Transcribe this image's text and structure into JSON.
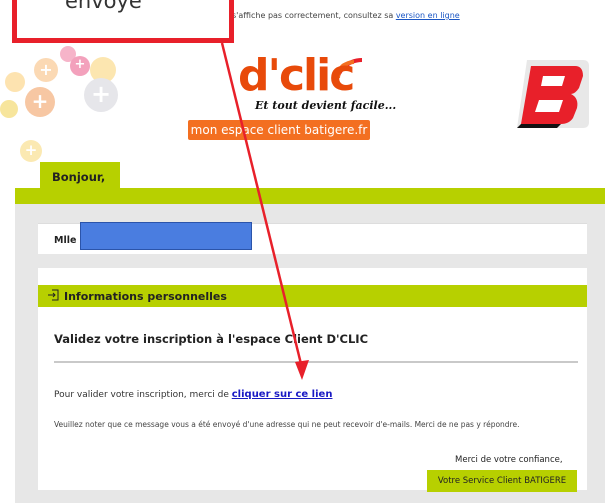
{
  "preheader": {
    "text": "s'affiche pas correctement, consultez sa ",
    "link": "version en ligne"
  },
  "logo": {
    "brand": "d'clic",
    "tagline": "Et tout devient facile...",
    "banner": "mon espace client batigere.fr"
  },
  "greeting": "Bonjour,",
  "recipient": {
    "label": "Mlle"
  },
  "section": {
    "icon": "enter-icon",
    "title": "Informations personnelles"
  },
  "content": {
    "heading": "Validez votre inscription à l'espace Client D'CLIC",
    "validate_text": "Pour valider votre inscription, merci de ",
    "validate_link": "cliquer sur ce lien",
    "notice": "Veuillez noter que ce message vous a été envoyé d'une adresse qui ne peut recevoir d'e-mails. Merci de ne pas y répondre.",
    "thanks": "Merci de votre confiance,",
    "signature": "Votre Service Client BATIGERE"
  },
  "annotation": {
    "text": "envoyé",
    "color": "#e8202a"
  },
  "colors": {
    "accent_green": "#b7d000",
    "brand_orange": "#f36f21",
    "brand_red": "#e8202a",
    "link_blue": "#1a1ac4"
  }
}
